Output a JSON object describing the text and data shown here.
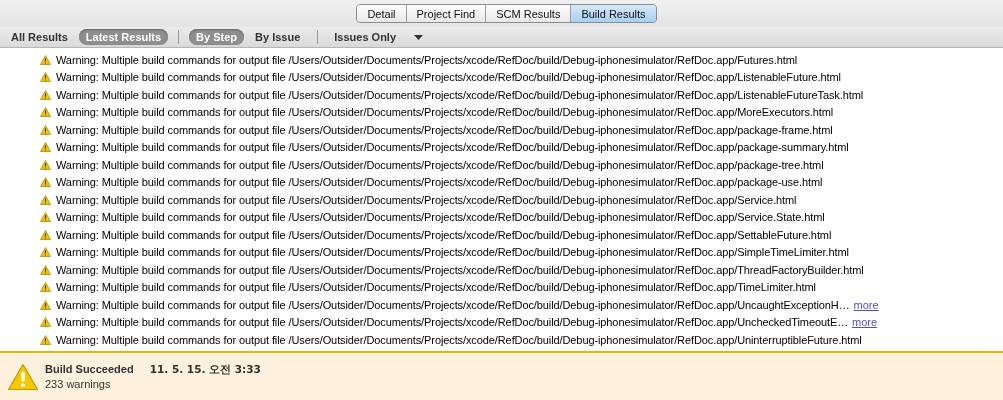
{
  "tabs": [
    {
      "label": "Detail",
      "selected": false
    },
    {
      "label": "Project Find",
      "selected": false
    },
    {
      "label": "SCM Results",
      "selected": false
    },
    {
      "label": "Build Results",
      "selected": true
    }
  ],
  "scope_filters": [
    {
      "label": "All Results",
      "selected": false
    },
    {
      "label": "Latest Results",
      "selected": true
    }
  ],
  "grouping_filters": [
    {
      "label": "By Step",
      "selected": true
    },
    {
      "label": "By Issue",
      "selected": false
    }
  ],
  "issues_dropdown": {
    "value": "Issues Only"
  },
  "messages": [
    {
      "text": "Warning: Multiple build commands for output file /Users/Outsider/Documents/Projects/xcode/RefDoc/build/Debug-iphonesimulator/RefDoc.app/Futures.html"
    },
    {
      "text": "Warning: Multiple build commands for output file /Users/Outsider/Documents/Projects/xcode/RefDoc/build/Debug-iphonesimulator/RefDoc.app/ListenableFuture.html"
    },
    {
      "text": "Warning: Multiple build commands for output file /Users/Outsider/Documents/Projects/xcode/RefDoc/build/Debug-iphonesimulator/RefDoc.app/ListenableFutureTask.html"
    },
    {
      "text": "Warning: Multiple build commands for output file /Users/Outsider/Documents/Projects/xcode/RefDoc/build/Debug-iphonesimulator/RefDoc.app/MoreExecutors.html"
    },
    {
      "text": "Warning: Multiple build commands for output file /Users/Outsider/Documents/Projects/xcode/RefDoc/build/Debug-iphonesimulator/RefDoc.app/package-frame.html"
    },
    {
      "text": "Warning: Multiple build commands for output file /Users/Outsider/Documents/Projects/xcode/RefDoc/build/Debug-iphonesimulator/RefDoc.app/package-summary.html"
    },
    {
      "text": "Warning: Multiple build commands for output file /Users/Outsider/Documents/Projects/xcode/RefDoc/build/Debug-iphonesimulator/RefDoc.app/package-tree.html"
    },
    {
      "text": "Warning: Multiple build commands for output file /Users/Outsider/Documents/Projects/xcode/RefDoc/build/Debug-iphonesimulator/RefDoc.app/package-use.html"
    },
    {
      "text": "Warning: Multiple build commands for output file /Users/Outsider/Documents/Projects/xcode/RefDoc/build/Debug-iphonesimulator/RefDoc.app/Service.html"
    },
    {
      "text": "Warning: Multiple build commands for output file /Users/Outsider/Documents/Projects/xcode/RefDoc/build/Debug-iphonesimulator/RefDoc.app/Service.State.html"
    },
    {
      "text": "Warning: Multiple build commands for output file /Users/Outsider/Documents/Projects/xcode/RefDoc/build/Debug-iphonesimulator/RefDoc.app/SettableFuture.html"
    },
    {
      "text": "Warning: Multiple build commands for output file /Users/Outsider/Documents/Projects/xcode/RefDoc/build/Debug-iphonesimulator/RefDoc.app/SimpleTimeLimiter.html"
    },
    {
      "text": "Warning: Multiple build commands for output file /Users/Outsider/Documents/Projects/xcode/RefDoc/build/Debug-iphonesimulator/RefDoc.app/ThreadFactoryBuilder.html"
    },
    {
      "text": "Warning: Multiple build commands for output file /Users/Outsider/Documents/Projects/xcode/RefDoc/build/Debug-iphonesimulator/RefDoc.app/TimeLimiter.html"
    },
    {
      "text": "Warning: Multiple build commands for output file /Users/Outsider/Documents/Projects/xcode/RefDoc/build/Debug-iphonesimulator/RefDoc.app/UncaughtExceptionH…",
      "more_link": "more"
    },
    {
      "text": "Warning: Multiple build commands for output file /Users/Outsider/Documents/Projects/xcode/RefDoc/build/Debug-iphonesimulator/RefDoc.app/UncheckedTimeoutE…",
      "more_link": "more"
    },
    {
      "text": "Warning: Multiple build commands for output file /Users/Outsider/Documents/Projects/xcode/RefDoc/build/Debug-iphonesimulator/RefDoc.app/UninterruptibleFuture.html"
    }
  ],
  "status": {
    "title": "Build Succeeded",
    "time": "11. 5. 15. 오전 3:33",
    "warnings": "233 warnings"
  }
}
